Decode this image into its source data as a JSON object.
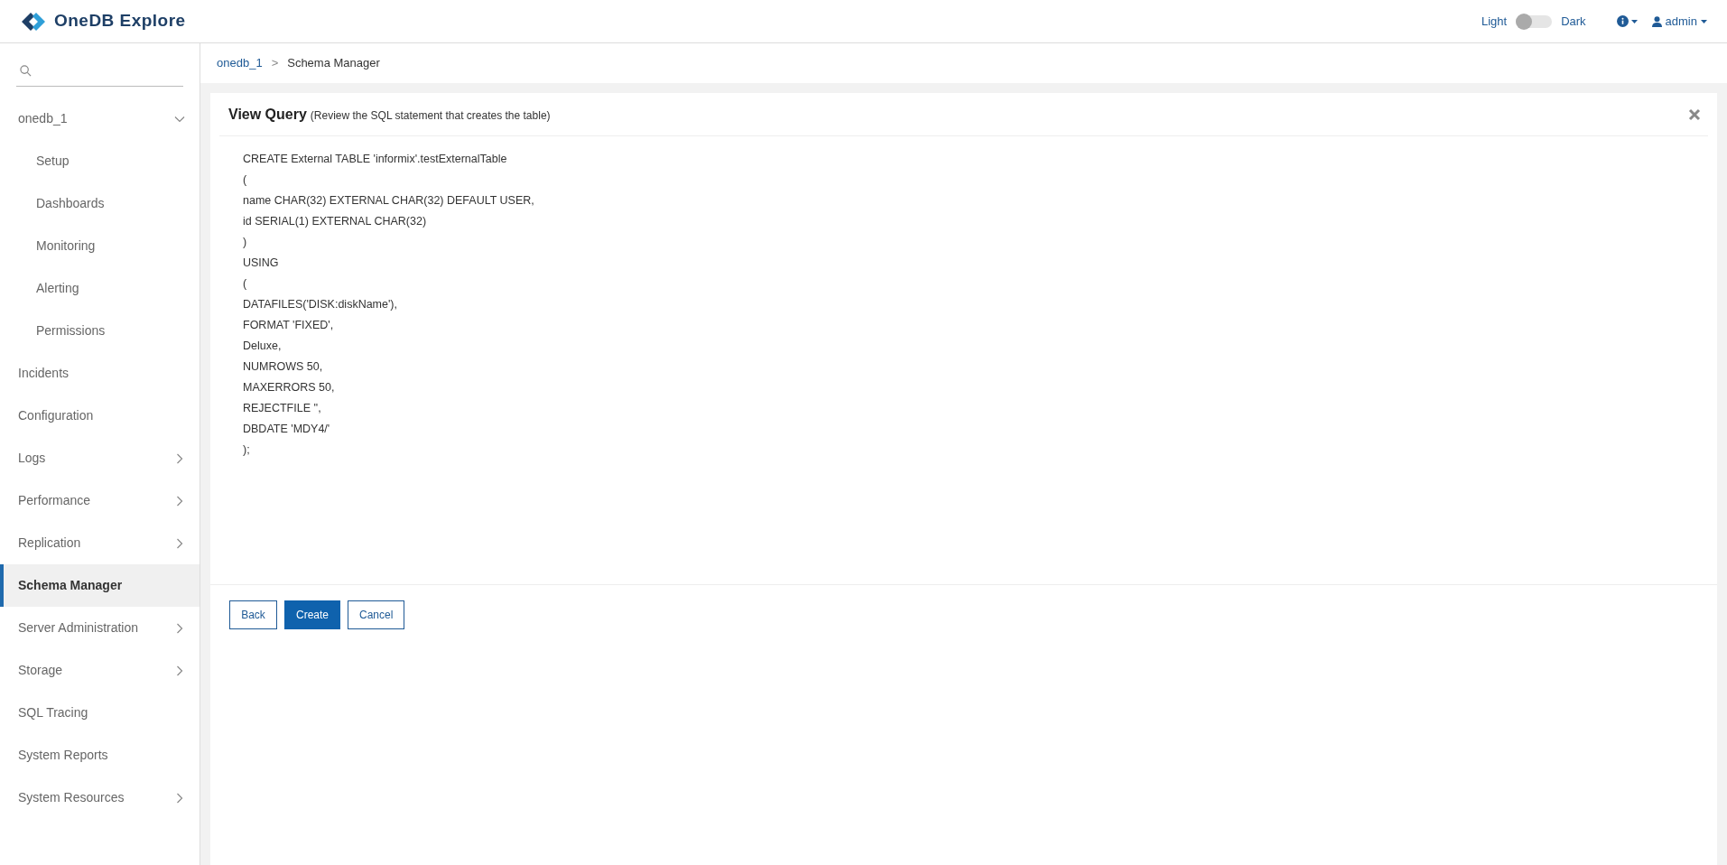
{
  "header": {
    "logo_text": "OneDB Explore",
    "theme_toggle": {
      "left_label": "Light",
      "right_label": "Dark",
      "on": false
    },
    "user": "admin"
  },
  "sidebar": {
    "items": [
      {
        "label": "onedb_1",
        "expanded": true,
        "selected": false,
        "children": [
          {
            "label": "Setup",
            "selected": false
          },
          {
            "label": "Dashboards",
            "selected": false
          },
          {
            "label": "Monitoring",
            "selected": false
          },
          {
            "label": "Alerting",
            "selected": false
          },
          {
            "label": "Permissions",
            "selected": false
          }
        ]
      },
      {
        "label": "Incidents",
        "selected": false
      },
      {
        "label": "Configuration",
        "selected": false
      },
      {
        "label": "Logs",
        "expanded": false,
        "selected": false
      },
      {
        "label": "Performance",
        "expanded": false,
        "selected": false
      },
      {
        "label": "Replication",
        "expanded": false,
        "selected": false
      },
      {
        "label": "Schema Manager",
        "selected": true
      },
      {
        "label": "Server Administration",
        "expanded": false,
        "selected": false
      },
      {
        "label": "Storage",
        "expanded": false,
        "selected": false
      },
      {
        "label": "SQL Tracing",
        "selected": false
      },
      {
        "label": "System Reports",
        "selected": false
      },
      {
        "label": "System Resources",
        "expanded": false,
        "selected": false
      }
    ]
  },
  "breadcrumb": [
    "onedb_1",
    "Schema Manager"
  ],
  "breadcrumb_separator": ">",
  "panel": {
    "title": "View Query",
    "subtitle": "(Review the SQL statement that creates the table)",
    "sql_lines": [
      "CREATE External TABLE 'informix'.testExternalTable",
      "(",
      "name CHAR(32) EXTERNAL CHAR(32) DEFAULT USER,",
      "id SERIAL(1) EXTERNAL CHAR(32)",
      ")",
      "USING",
      "(",
      "DATAFILES('DISK:diskName'),",
      "FORMAT 'FIXED',",
      "Deluxe,",
      "NUMROWS 50,",
      "MAXERRORS 50,",
      "REJECTFILE '',",
      "DBDATE 'MDY4/'",
      ");"
    ],
    "buttons": [
      {
        "label": "Back",
        "kind": "outline"
      },
      {
        "label": "Create",
        "kind": "primary"
      },
      {
        "label": "Cancel",
        "kind": "outline"
      }
    ]
  }
}
